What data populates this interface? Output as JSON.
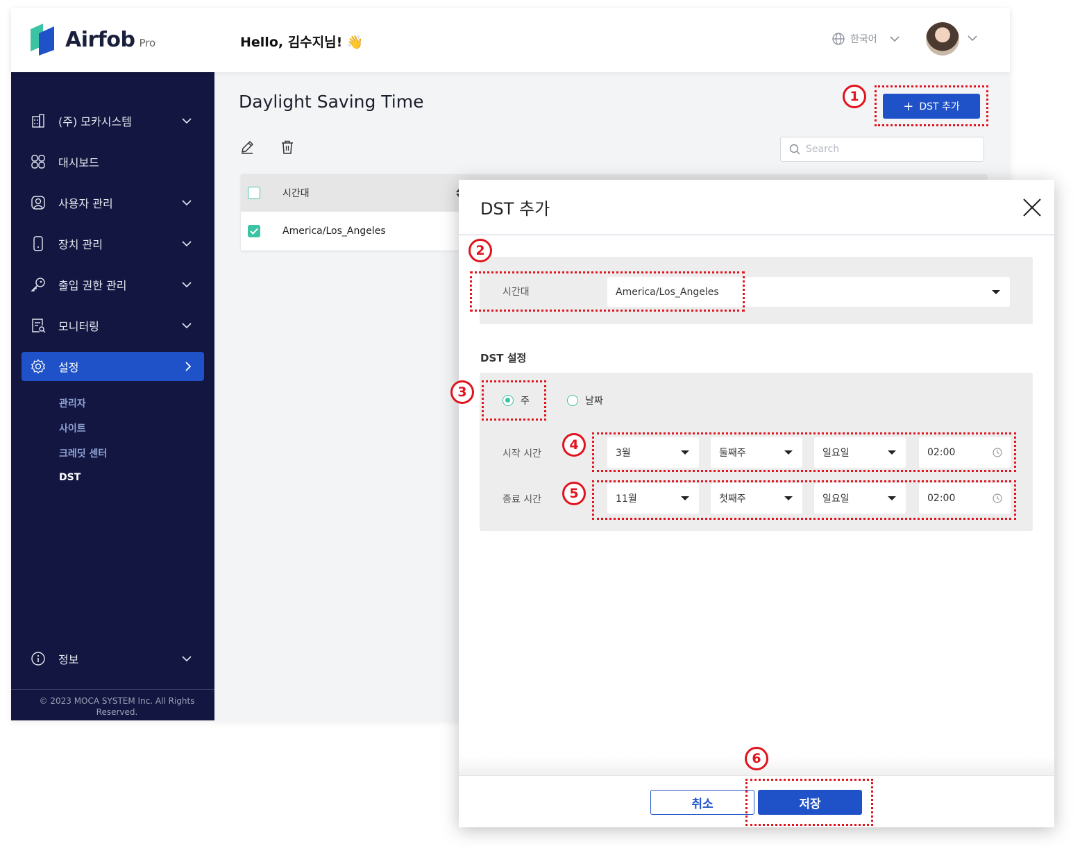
{
  "header": {
    "logo_text": "Airfob",
    "logo_sub": "Pro",
    "greeting": "Hello, 김수지님! 👋",
    "language": "한국어"
  },
  "sidebar": {
    "items": [
      {
        "label": "(주) 모카시스템",
        "icon": "building-icon"
      },
      {
        "label": "대시보드",
        "icon": "dashboard-grid-icon"
      },
      {
        "label": "사용자 관리",
        "icon": "user-icon"
      },
      {
        "label": "장치 관리",
        "icon": "device-icon"
      },
      {
        "label": "출입 권한 관리",
        "icon": "key-icon"
      },
      {
        "label": "모니터링",
        "icon": "monitoring-icon"
      },
      {
        "label": "설정",
        "icon": "gear-icon"
      }
    ],
    "sub_items": [
      "관리자",
      "사이트",
      "크레딧 센터",
      "DST"
    ],
    "info_label": "정보",
    "copyright": "© 2023 MOCA SYSTEM Inc. All Rights Reserved."
  },
  "main": {
    "title": "Daylight Saving Time",
    "add_button": "DST 추가",
    "search_placeholder": "Search",
    "table": {
      "header": "시간대",
      "rows": [
        {
          "timezone": "America/Los_Angeles",
          "checked": true
        }
      ]
    }
  },
  "modal": {
    "title": "DST 추가",
    "timezone_label": "시간대",
    "timezone_value": "America/Los_Angeles",
    "dst_section_label": "DST 설정",
    "radio_week": "주",
    "radio_date": "날짜",
    "selected_mode": "주",
    "start": {
      "label": "시작 시간",
      "month": "3월",
      "week": "둘째주",
      "day": "일요일",
      "time": "02:00"
    },
    "end": {
      "label": "종료 시간",
      "month": "11월",
      "week": "첫째주",
      "day": "일요일",
      "time": "02:00"
    },
    "cancel": "취소",
    "save": "저장"
  },
  "annotations": [
    "1",
    "2",
    "3",
    "4",
    "5",
    "6"
  ],
  "colors": {
    "accent": "#1f52c8",
    "sidebar": "#131640",
    "teal": "#3cc3a3",
    "highlight": "#e0141e"
  }
}
